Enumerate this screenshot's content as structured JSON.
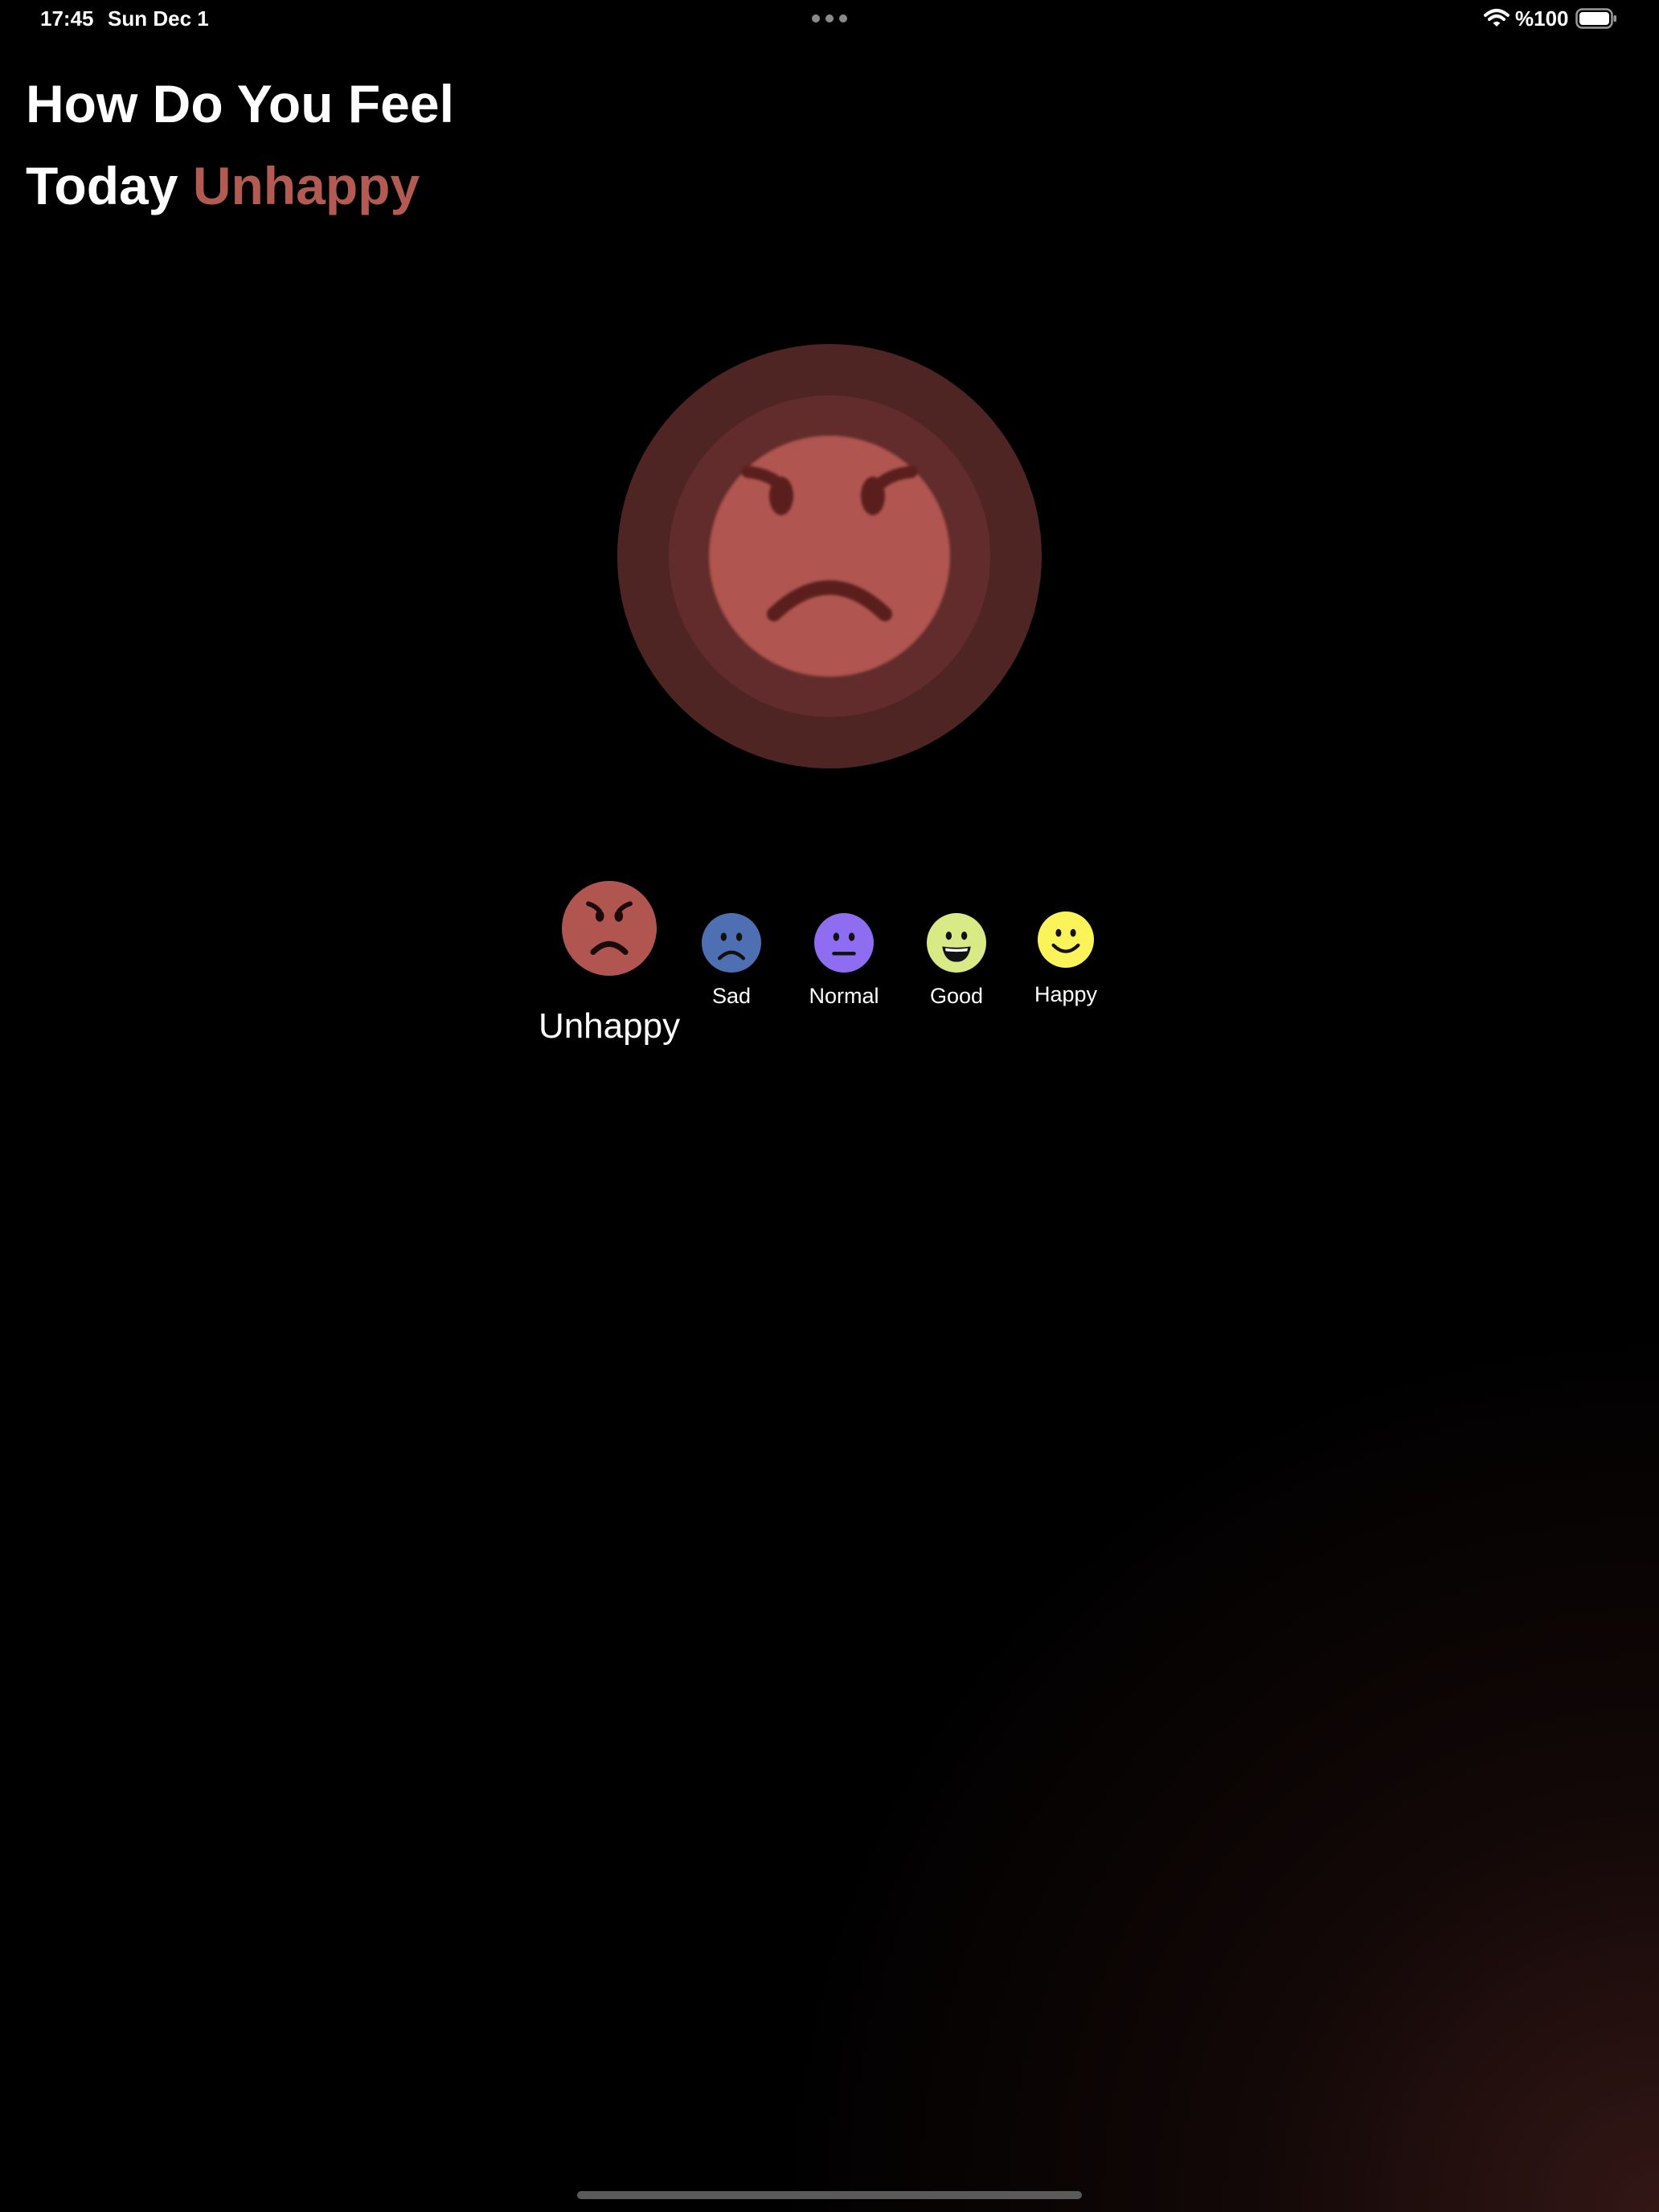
{
  "status_bar": {
    "time": "17:45",
    "date": "Sun Dec 1",
    "battery": "%100",
    "icons": [
      "multitask-dots-icon",
      "wifi-icon",
      "battery-icon"
    ]
  },
  "title": {
    "line1": "How Do You Feel",
    "line2_prefix": "Today",
    "mood": "Unhappy",
    "mood_color": "#b35b53"
  },
  "current_mood": {
    "name": "Unhappy",
    "icon": "angry-face-icon",
    "color": "#b0554f"
  },
  "moods": [
    {
      "label": "Unhappy",
      "icon": "angry-face-icon",
      "color": "#b0554f",
      "selected": true
    },
    {
      "label": "Sad",
      "icon": "sad-face-icon",
      "color": "#4f6fb3",
      "selected": false
    },
    {
      "label": "Normal",
      "icon": "neutral-face-icon",
      "color": "#8f6df0",
      "selected": false
    },
    {
      "label": "Good",
      "icon": "grinning-face-icon",
      "color": "#d7ea86",
      "selected": false
    },
    {
      "label": "Happy",
      "icon": "smiling-face-icon",
      "color": "#fbf35a",
      "selected": false
    }
  ]
}
